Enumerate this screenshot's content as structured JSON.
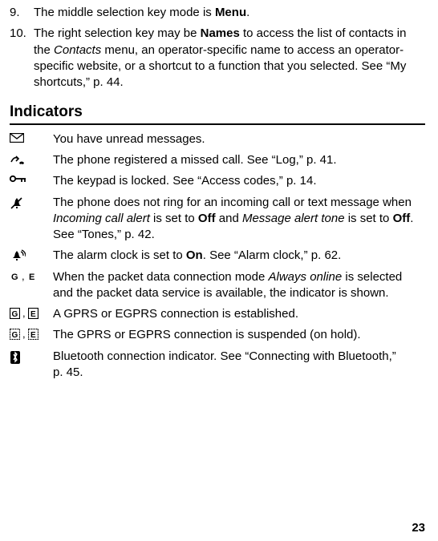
{
  "list9": {
    "num": "9.",
    "pre": "The middle selection key mode is ",
    "bold": "Menu",
    "post": "."
  },
  "list10": {
    "num": "10.",
    "p1": "The right selection key may be ",
    "b1": "Names",
    "p2": " to access the list of contacts in the ",
    "i1": "Contacts",
    "p3": " menu, an operator-specific name to access an operator-specific website, or a shortcut to a function that you selected. See “My shortcuts,” p. 44."
  },
  "sectionTitle": "Indicators",
  "ind": {
    "unread": "You have unread messages.",
    "missed": "The phone registered a missed call. See “Log,” p. 41.",
    "locked": "The keypad is locked. See “Access codes,” p. 14.",
    "silent": {
      "p1": "The phone does not ring for an incoming call or text message when ",
      "i1": "Incoming call alert",
      "p2": " is set to ",
      "b1": "Off",
      "p3": " and ",
      "i2": "Message alert tone",
      "p4": " is set to ",
      "b2": "Off",
      "p5": ". See “Tones,” p. 42."
    },
    "alarm": {
      "p1": "The alarm clock is set to ",
      "b1": "On",
      "p2": ". See “Alarm clock,” p. 62."
    },
    "packet": {
      "p1": "When the packet data connection mode ",
      "i1": "Always online",
      "p2": " is selected and the packet data service is available, the indicator is shown."
    },
    "gprs": "A GPRS or EGPRS connection is established.",
    "suspended": "The GPRS or EGPRS connection is suspended (on hold).",
    "bt": "Bluetooth connection indicator. See “Connecting with Bluetooth,” p. 45."
  },
  "comma": ",",
  "pageNumber": "23"
}
